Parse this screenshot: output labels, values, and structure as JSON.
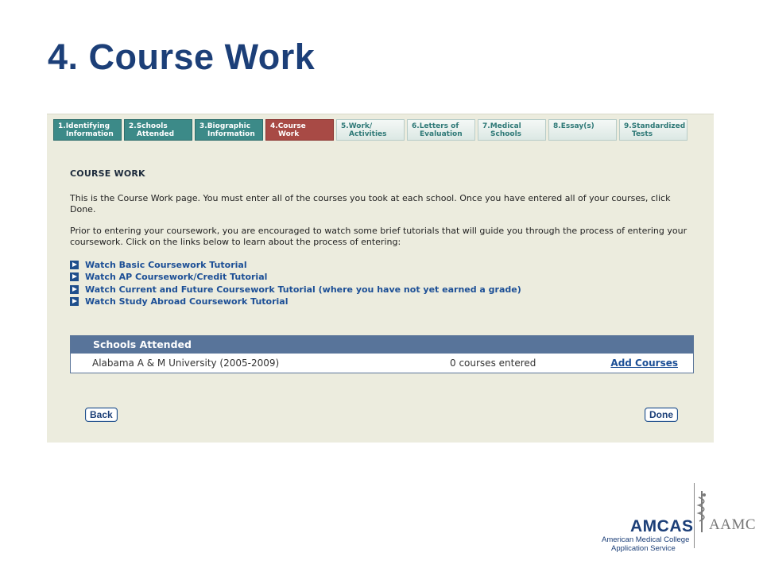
{
  "slide": {
    "title": "4. Course Work"
  },
  "tabs": [
    {
      "num": "1.",
      "line1": "Identifying",
      "line2": "Information",
      "state": "done"
    },
    {
      "num": "2.",
      "line1": "Schools",
      "line2": "Attended",
      "state": "done"
    },
    {
      "num": "3.",
      "line1": "Biographic",
      "line2": "Information",
      "state": "done"
    },
    {
      "num": "4.",
      "line1": "Course",
      "line2": "Work",
      "state": "active"
    },
    {
      "num": "5.",
      "line1": "Work/",
      "line2": "Activities",
      "state": "todo"
    },
    {
      "num": "6.",
      "line1": "Letters of",
      "line2": "Evaluation",
      "state": "todo"
    },
    {
      "num": "7.",
      "line1": "Medical",
      "line2": "Schools",
      "state": "todo"
    },
    {
      "num": "8.",
      "line1": "Essay(s)",
      "line2": "",
      "state": "todo"
    },
    {
      "num": "9.",
      "line1": "Standardized",
      "line2": "Tests",
      "state": "todo"
    }
  ],
  "page": {
    "heading": "COURSE WORK",
    "intro": "This is the Course Work page. You must enter all of the courses you took at each school. Once you have entered all of your courses, click Done.",
    "prior": "Prior to entering your coursework, you are encouraged to watch some brief tutorials that will guide you through the process of entering your coursework. Click on the links below to learn about the process of entering:",
    "tutorials": [
      "Watch Basic Coursework Tutorial",
      "Watch AP Coursework/Credit Tutorial",
      "Watch Current and Future Coursework Tutorial (where you have not yet earned a grade)",
      "Watch Study Abroad Coursework Tutorial"
    ]
  },
  "schools": {
    "header": "Schools Attended",
    "rows": [
      {
        "name": "Alabama A & M University (2005-2009)",
        "count": "0 courses entered",
        "action": "Add Courses"
      }
    ]
  },
  "buttons": {
    "back": "Back",
    "done": "Done"
  },
  "logo": {
    "amcas": "AMCAS",
    "line1": "American Medical College",
    "line2": "Application Service",
    "aamc": "AAMC"
  },
  "colors": {
    "title": "#1c3f78",
    "tab_done": "#3c8a88",
    "tab_active": "#a84a45",
    "panel_bg": "#ececde",
    "table_header": "#58749a",
    "link": "#1c4f96"
  }
}
